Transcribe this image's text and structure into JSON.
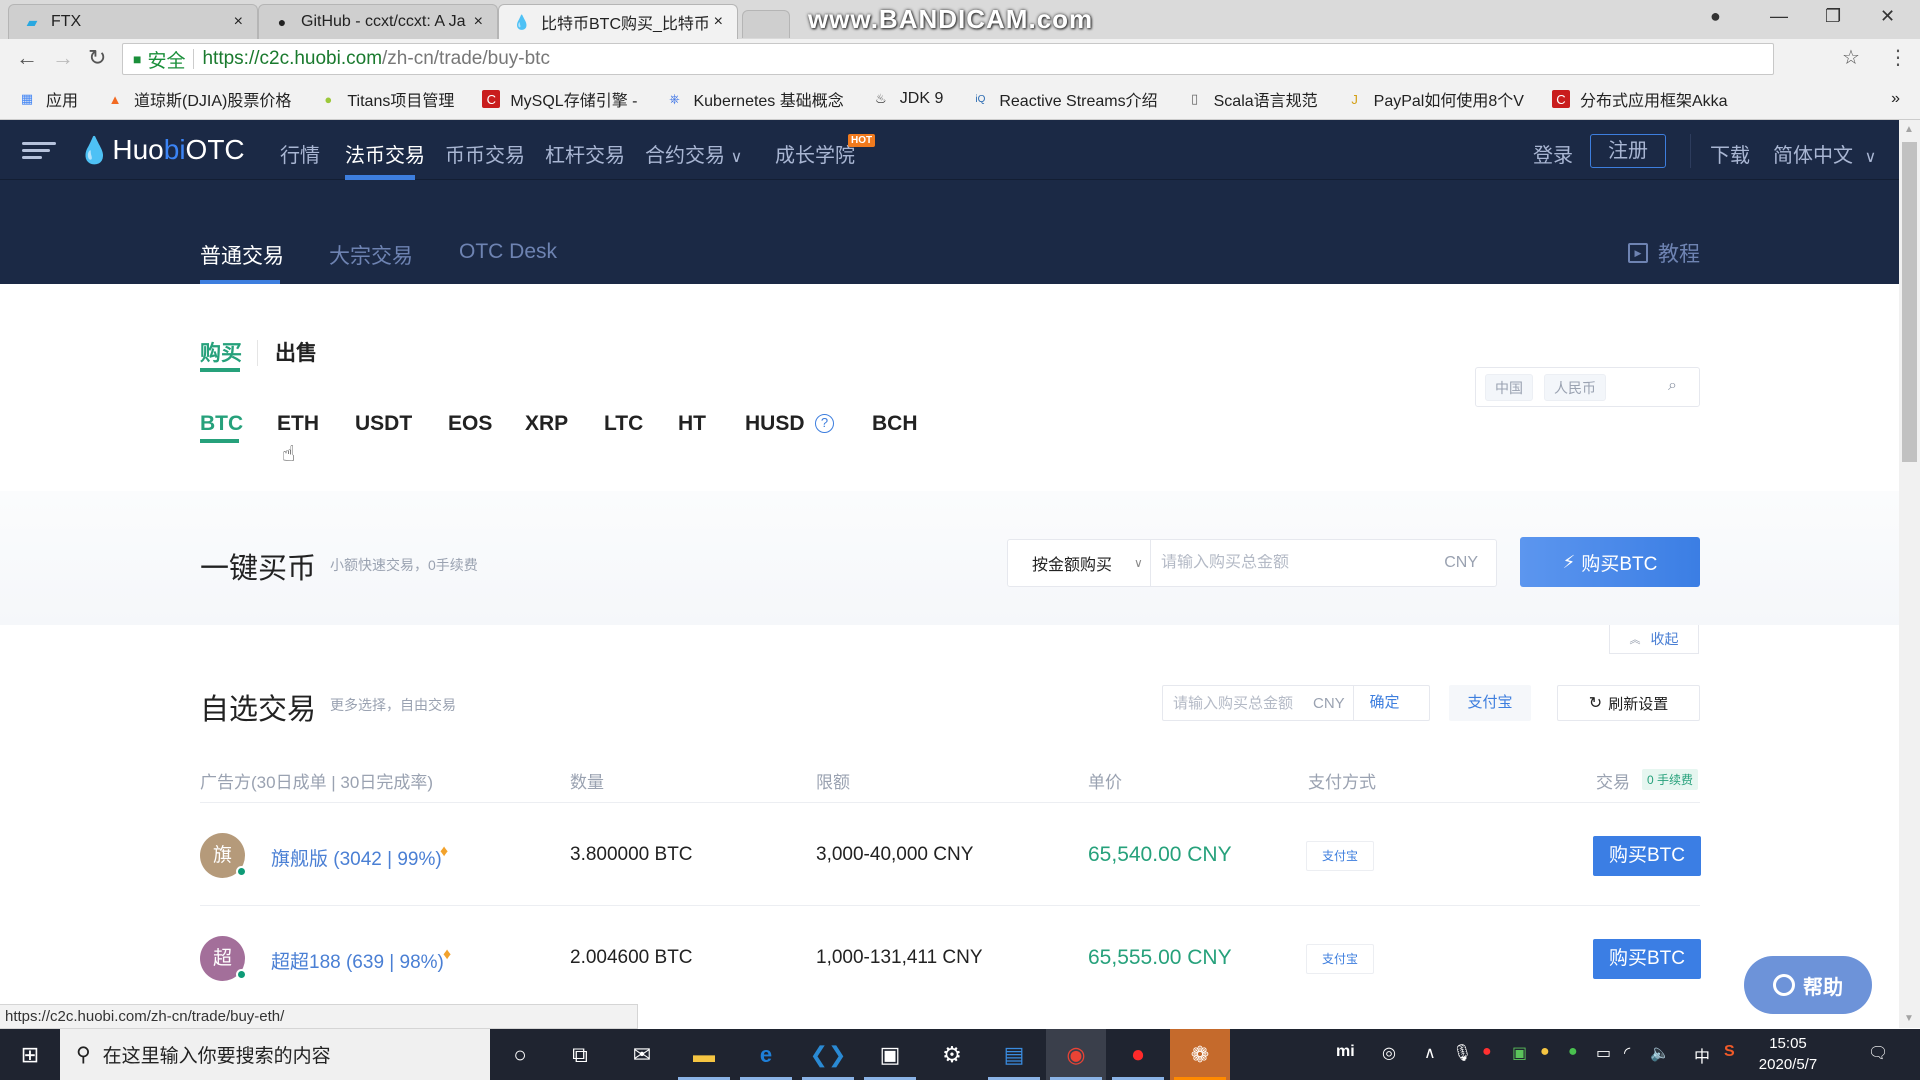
{
  "browser": {
    "tabs": [
      {
        "title": "FTX",
        "icon": "ftx-icon",
        "close": "×"
      },
      {
        "title": "GitHub - ccxt/ccxt: A Ja",
        "icon": "github-icon",
        "close": "×"
      },
      {
        "title": "比特币BTC购买_比特币B",
        "icon": "huobi-icon",
        "close": "×",
        "active": true
      }
    ],
    "watermark": "www.BANDICAM.com",
    "address": {
      "security_label": "安全",
      "url_scheme_host": "https://c2c.huobi.com",
      "url_path": "/zh-cn/trade/buy-btc"
    },
    "bookmarks": [
      {
        "label": "应用",
        "icon": "apps-grid-icon"
      },
      {
        "label": "道琼斯(DJIA)股票价格",
        "icon": "flame-icon"
      },
      {
        "label": "Titans项目管理",
        "icon": "leaf-icon"
      },
      {
        "label": "MySQL存储引擎 - ",
        "icon": "csdn-icon"
      },
      {
        "label": "Kubernetes 基础概念",
        "icon": "kubernetes-icon"
      },
      {
        "label": "JDK 9",
        "icon": "jdk-icon"
      },
      {
        "label": "Reactive Streams介绍",
        "icon": "infoq-icon"
      },
      {
        "label": "Scala语言规范",
        "icon": "document-icon"
      },
      {
        "label": "PayPal如何使用8个V",
        "icon": "jianshu-icon"
      },
      {
        "label": "分布式应用框架Akka",
        "icon": "csdn-icon"
      }
    ],
    "bookmarks_overflow": "»",
    "status_url": "https://c2c.huobi.com/zh-cn/trade/buy-eth/"
  },
  "header": {
    "logo_main": "Huo",
    "logo_accent": "bi",
    "logo_suffix": " OTC",
    "nav": [
      "行情",
      "法币交易",
      "币币交易",
      "杠杆交易",
      "合约交易",
      "成长学院"
    ],
    "active_nav": "法币交易",
    "hot_badge": "HOT",
    "login": "登录",
    "register": "注册",
    "download": "下载",
    "language": "简体中文"
  },
  "subnav": {
    "items": [
      "普通交易",
      "大宗交易",
      "OTC Desk"
    ],
    "active": "普通交易",
    "tutorial": "教程"
  },
  "trade": {
    "buy": "购买",
    "sell": "出售",
    "active_side": "购买",
    "coins": [
      "BTC",
      "ETH",
      "USDT",
      "EOS",
      "XRP",
      "LTC",
      "HT",
      "HUSD",
      "BCH"
    ],
    "active_coin": "BTC",
    "filter": {
      "country": "中国",
      "currency": "人民币"
    }
  },
  "one_click": {
    "title": "一键买币",
    "subtitle": "小额快速交易，0手续费",
    "mode": "按金额购买",
    "input_placeholder": "请输入购买总金额",
    "currency": "CNY",
    "button": "购买BTC",
    "collapse": "收起"
  },
  "free_trade": {
    "title": "自选交易",
    "subtitle": "更多选择，自由交易",
    "amount_placeholder": "请输入购买总金额",
    "currency": "CNY",
    "confirm": "确定",
    "payment_filter": "支付宝",
    "refresh": "刷新设置",
    "columns": [
      "广告方(30日成单 | 30日完成率)",
      "数量",
      "限额",
      "单价",
      "支付方式",
      "交易"
    ],
    "fee_badge": "0 手续费",
    "rows": [
      {
        "avatar": "旗",
        "avatar_color": "#b59a7a",
        "merchant": "旗舰版 (3042 | 99%)",
        "quantity": "3.800000 BTC",
        "limit": "3,000-40,000 CNY",
        "price": "65,540.00 CNY",
        "payment": "支付宝",
        "action": "购买BTC"
      },
      {
        "avatar": "超",
        "avatar_color": "#a36f9a",
        "merchant": "超超188 (639 | 98%)",
        "quantity": "2.004600 BTC",
        "limit": "1,000-131,411 CNY",
        "price": "65,555.00 CNY",
        "payment": "支付宝",
        "action": "购买BTC"
      }
    ]
  },
  "help": "帮助",
  "taskbar": {
    "search_placeholder": "在这里输入你要搜索的内容",
    "time": "15:05",
    "date": "2020/5/7",
    "ime": "中"
  }
}
